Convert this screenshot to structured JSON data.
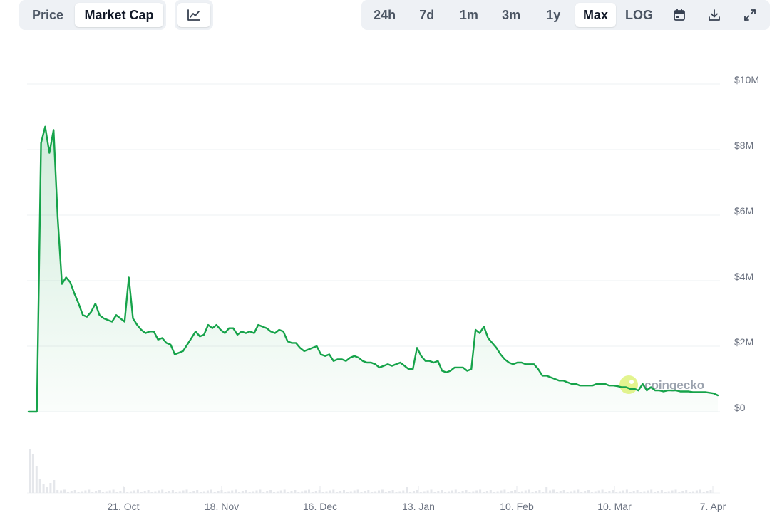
{
  "toolbar": {
    "left_tabs": [
      {
        "label": "Price",
        "active": false
      },
      {
        "label": "Market Cap",
        "active": true
      }
    ],
    "chart_type_icon": "line-chart-icon",
    "ranges": [
      {
        "label": "24h",
        "active": false
      },
      {
        "label": "7d",
        "active": false
      },
      {
        "label": "1m",
        "active": false
      },
      {
        "label": "3m",
        "active": false
      },
      {
        "label": "1y",
        "active": false
      },
      {
        "label": "Max",
        "active": true
      },
      {
        "label": "LOG",
        "active": false
      }
    ],
    "icons": [
      "calendar-icon",
      "download-icon",
      "expand-icon"
    ]
  },
  "watermark": {
    "text": "coingecko",
    "icon": "gecko-logo-icon"
  },
  "colors": {
    "line": "#16a34a",
    "area_top": "#dcf3e3",
    "grid": "#eef0f3",
    "tick_text": "#6b7280",
    "volume": "#e5e7eb"
  },
  "chart_data": {
    "type": "area",
    "title": "",
    "xlabel": "",
    "ylabel": "",
    "x_tick_labels": [
      "21. Oct",
      "18. Nov",
      "16. Dec",
      "13. Jan",
      "10. Feb",
      "10. Mar",
      "7. Apr"
    ],
    "y_tick_labels": [
      "$0",
      "$2M",
      "$4M",
      "$6M",
      "$8M",
      "$10M"
    ],
    "ylim": [
      0,
      10000000
    ],
    "grid": true,
    "series": [
      {
        "values": [
          0,
          0,
          0,
          8200000,
          8700000,
          7900000,
          8600000,
          5900000,
          3900000,
          4100000,
          3950000,
          3600000,
          3300000,
          2950000,
          2900000,
          3050000,
          3300000,
          2950000,
          2850000,
          2800000,
          2750000,
          2950000,
          2850000,
          2750000,
          4100000,
          2850000,
          2650000,
          2500000,
          2400000,
          2450000,
          2450000,
          2200000,
          2250000,
          2100000,
          2050000,
          1750000,
          1800000,
          1850000,
          2050000,
          2250000,
          2450000,
          2300000,
          2350000,
          2650000,
          2550000,
          2650000,
          2500000,
          2400000,
          2550000,
          2550000,
          2350000,
          2450000,
          2400000,
          2450000,
          2400000,
          2650000,
          2600000,
          2550000,
          2450000,
          2400000,
          2500000,
          2450000,
          2150000,
          2100000,
          2100000,
          1950000,
          1850000,
          1900000,
          1950000,
          2000000,
          1750000,
          1700000,
          1750000,
          1550000,
          1600000,
          1600000,
          1550000,
          1650000,
          1700000,
          1650000,
          1550000,
          1500000,
          1500000,
          1450000,
          1350000,
          1400000,
          1450000,
          1400000,
          1450000,
          1500000,
          1400000,
          1300000,
          1300000,
          1950000,
          1700000,
          1550000,
          1550000,
          1500000,
          1550000,
          1250000,
          1200000,
          1250000,
          1350000,
          1350000,
          1350000,
          1250000,
          1300000,
          2500000,
          2400000,
          2600000,
          2250000,
          2100000,
          1950000,
          1750000,
          1600000,
          1500000,
          1450000,
          1500000,
          1500000,
          1450000,
          1450000,
          1450000,
          1300000,
          1100000,
          1100000,
          1050000,
          1000000,
          950000,
          950000,
          900000,
          850000,
          850000,
          800000,
          800000,
          800000,
          800000,
          850000,
          850000,
          850000,
          800000,
          800000,
          780000,
          750000,
          750000,
          700000,
          700000,
          650000,
          850000,
          650000,
          750000,
          650000,
          650000,
          620000,
          650000,
          650000,
          650000,
          620000,
          620000,
          620000,
          600000,
          600000,
          600000,
          600000,
          580000,
          560000,
          500000
        ]
      }
    ]
  }
}
